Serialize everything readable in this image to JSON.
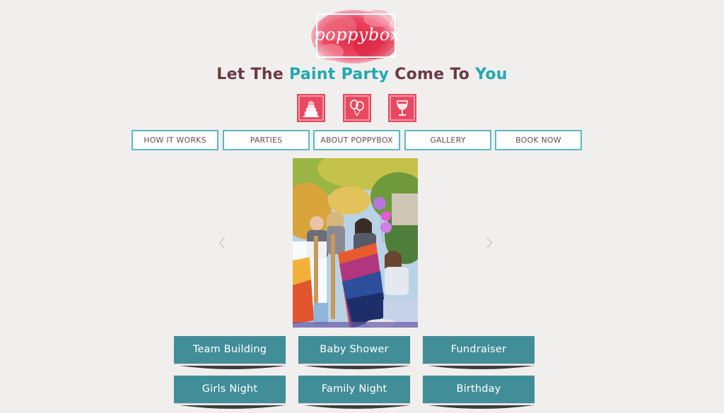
{
  "brand": {
    "logo_text": "poppybox",
    "colors": {
      "accent_teal": "#22a7b0",
      "heading_plum": "#6a3a44",
      "button_teal": "#428e98",
      "nav_border": "#5cb8c4",
      "logo_red": "#e8394e"
    }
  },
  "tagline": {
    "part1": "Let The ",
    "highlight1": "Paint Party",
    "part2": " Come To ",
    "highlight2": "You"
  },
  "party_icons": [
    {
      "icon": "birthday-cake-icon"
    },
    {
      "icon": "balloons-icon"
    },
    {
      "icon": "wine-glass-icon"
    }
  ],
  "nav": {
    "items": [
      {
        "label": "HOW IT WORKS"
      },
      {
        "label": "PARTIES"
      },
      {
        "label": "ABOUT POPPYBOX"
      },
      {
        "label": "GALLERY"
      },
      {
        "label": "BOOK NOW"
      }
    ]
  },
  "slideshow": {
    "prev_icon": "chevron-left-icon",
    "next_icon": "chevron-right-icon"
  },
  "party_buttons": {
    "row1": [
      {
        "label": "Team Building"
      },
      {
        "label": "Baby Shower"
      },
      {
        "label": "Fundraiser"
      }
    ],
    "row2": [
      {
        "label": "Girls Night"
      },
      {
        "label": "Family Night"
      },
      {
        "label": "Birthday"
      }
    ]
  }
}
